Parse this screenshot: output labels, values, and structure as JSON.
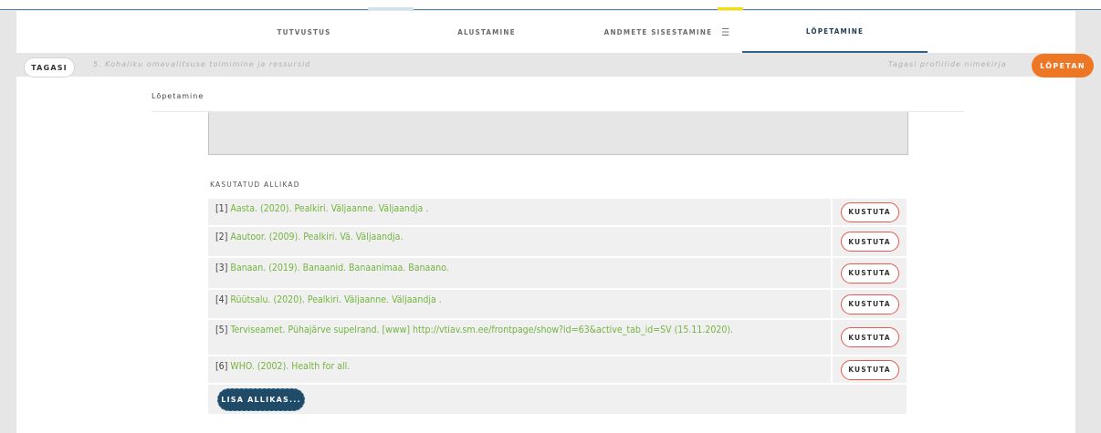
{
  "steps": [
    {
      "label": "TUTVUSTUS"
    },
    {
      "label": "ALUSTAMINE"
    },
    {
      "label": "ANDMETE SISESTAMINE"
    },
    {
      "label": "LÕPETAMINE"
    }
  ],
  "step_menu_icon": "menu-icon",
  "statusbar": {
    "back_label": "TAGASI",
    "section_title": "5. Kohaliku omavalitsuse toimimine ja ressursid",
    "back_to_list": "Tagasi profiilide nimekirja",
    "finish_label": "LÕPETAN"
  },
  "content": {
    "heading": "Lõpetamine",
    "sources_label": "KASUTATUD ALLIKAD",
    "delete_label": "KUSTUTA",
    "add_label": "LISA ALLIKAS...",
    "sources": [
      {
        "num": "[1]",
        "text": "Aasta. (2020). Pealkiri. Väljaanne. Väljaandja ."
      },
      {
        "num": "[2]",
        "text": "Aautoor. (2009). Pealkiri. Vä. Väljaandja."
      },
      {
        "num": "[3]",
        "text": "Banaan. (2019). Banaanid. Banaanimaa. Banaano."
      },
      {
        "num": "[4]",
        "text": "Rüütsalu. (2020). Pealkiri. Väljaanne. Väljaandja ."
      },
      {
        "num": "[5]",
        "text": "Terviseamet. Pühajärve supelrand. [www] http://vtiav.sm.ee/frontpage/show?id=63&active_tab_id=SV (15.11.2020)."
      },
      {
        "num": "[6]",
        "text": "WHO. (2002). Health for all."
      }
    ]
  },
  "colors": {
    "accent_orange": "#ee7726",
    "link_green": "#74b43f",
    "delete_border_red": "#e25a50",
    "add_button_navy": "#1f4a68",
    "active_tab": "#1b3d55"
  }
}
